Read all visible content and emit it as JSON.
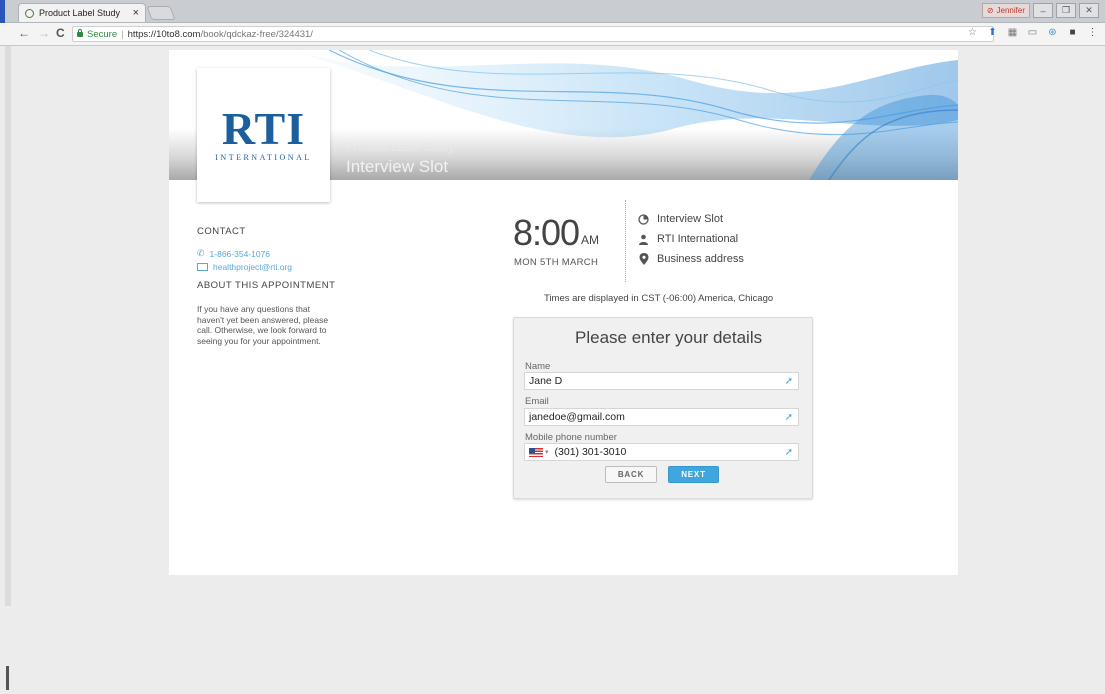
{
  "browser": {
    "tab_title": "Product Label Study",
    "tab_close": "×",
    "secure_label": "Secure",
    "url_host": "https://10to8.com",
    "url_path": "/book/qdckaz-free/324431/",
    "profile_label": "Jennifer",
    "window_controls": [
      "–",
      "❐",
      "✕"
    ],
    "nav": {
      "back": "←",
      "forward": "→",
      "reload": "C"
    },
    "extensions": [
      "star-icon",
      "shield-icon",
      "grid-icon",
      "cast-icon",
      "settings-icon",
      "box-icon",
      "menu-icon"
    ]
  },
  "banner": {
    "logo_text": "RTI",
    "logo_sub": "INTERNATIONAL",
    "subtitle": "Product Label Study",
    "title": "Interview Slot"
  },
  "contact": {
    "heading": "CONTACT",
    "phone": "1-866-354-1076",
    "email": "healthproject@rti.org"
  },
  "about": {
    "heading": "ABOUT THIS APPOINTMENT",
    "text": "If you have any questions that haven't yet been answered, please call. Otherwise, we look forward to seeing you for your appointment."
  },
  "appointment": {
    "time": "8:00",
    "ampm": "AM",
    "date": "MON 5TH MARCH",
    "service": "Interview Slot",
    "provider": "RTI International",
    "location": "Business address",
    "timezone_note": "Times are displayed in CST (-06:00) America, Chicago"
  },
  "form": {
    "title": "Please enter your details",
    "name_label": "Name",
    "name_value": "Jane D",
    "email_label": "Email",
    "email_value": "janedoe@gmail.com",
    "phone_label": "Mobile phone number",
    "phone_value": "(301) 301-3010",
    "back_label": "BACK",
    "next_label": "NEXT"
  },
  "colors": {
    "accent": "#3fa7de",
    "logo": "#1b5f9e",
    "link": "#5aa7d6",
    "secure": "#2e8b3c"
  }
}
